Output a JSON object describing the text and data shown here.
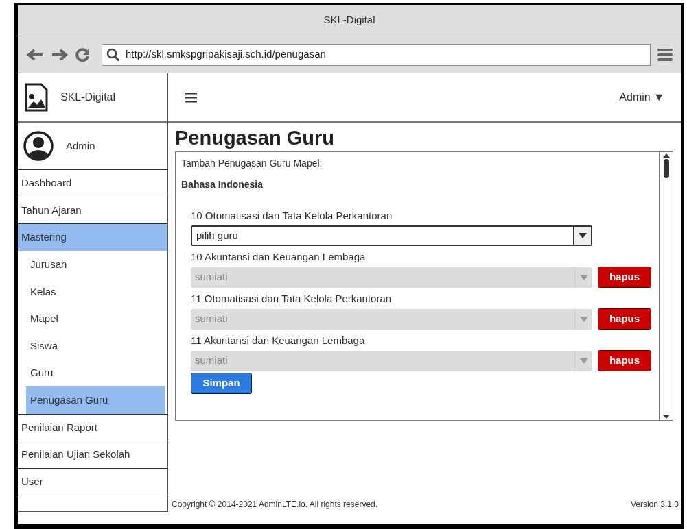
{
  "window": {
    "title": "SKL-Digital"
  },
  "browser": {
    "url": "http://skl.smkspgripakisaji.sch.id/penugasan"
  },
  "sidebar": {
    "brand": "SKL-Digital",
    "user": "Admin",
    "items": [
      {
        "label": "Dashboard",
        "selected": false
      },
      {
        "label": "Tahun Ajaran",
        "selected": false
      },
      {
        "label": "Mastering",
        "selected": true,
        "children": [
          {
            "label": "Jurusan",
            "selected": false
          },
          {
            "label": "Kelas",
            "selected": false
          },
          {
            "label": "Mapel",
            "selected": false
          },
          {
            "label": "Siswa",
            "selected": false
          },
          {
            "label": "Guru",
            "selected": false
          },
          {
            "label": "Penugasan Guru",
            "selected": true
          }
        ]
      },
      {
        "label": "Penilaian Raport",
        "selected": false
      },
      {
        "label": "Penilaian Ujian Sekolah",
        "selected": false
      },
      {
        "label": "User",
        "selected": false
      }
    ]
  },
  "header": {
    "user_menu": "Admin ▼"
  },
  "page": {
    "title": "Penugasan Guru",
    "intro": "Tambah Penugasan Guru Mapel:",
    "subject": "Bahasa Indonesia",
    "rows": [
      {
        "label": "10 Otomatisasi dan Tata Kelola Perkantoran",
        "value": "pilih guru",
        "disabled": false
      },
      {
        "label": "10 Akuntansi dan Keuangan Lembaga",
        "value": "sumiati",
        "disabled": true,
        "delete_button": "hapus"
      },
      {
        "label": "11 Otomatisasi dan Tata Kelola Perkantoran",
        "value": "sumiati",
        "disabled": true,
        "delete_button": "hapus"
      },
      {
        "label": "11 Akuntansi dan Keuangan Lembaga",
        "value": "sumiati",
        "disabled": true,
        "delete_button": "hapus"
      }
    ],
    "save_button": "Simpan"
  },
  "footer": {
    "copyright": "Copyright © 2014-2021 AdminLTE.io. All rights reserved.",
    "version": "Version 3.1.0"
  }
}
